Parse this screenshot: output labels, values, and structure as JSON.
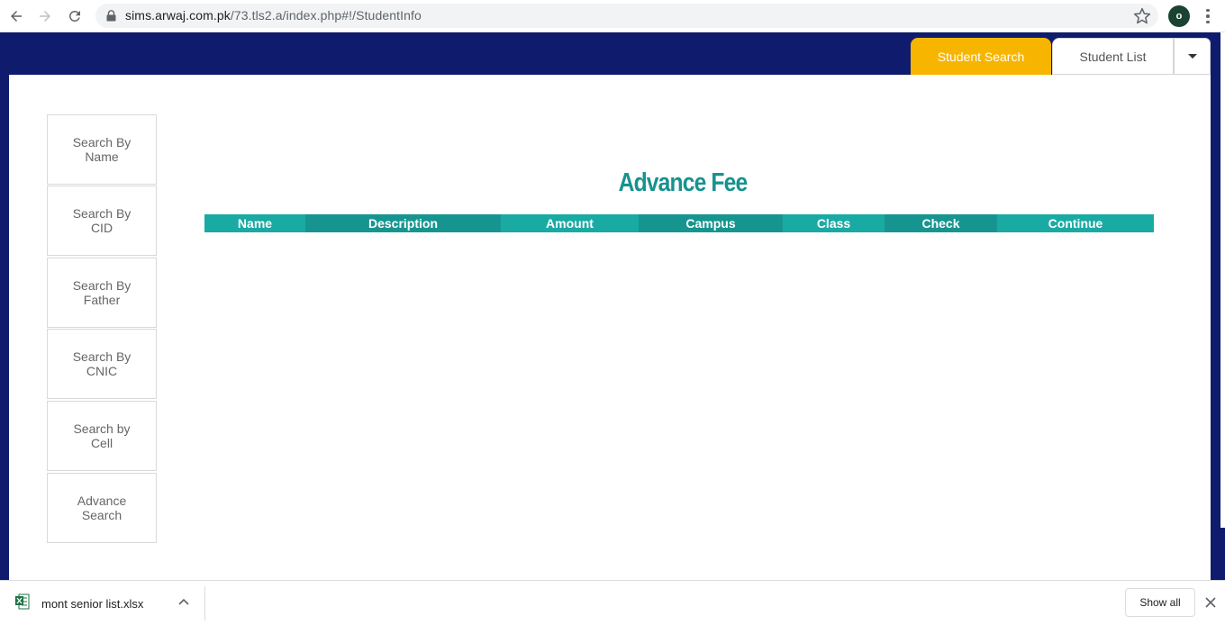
{
  "browser": {
    "url_domain": "sims.arwaj.com.pk",
    "url_path": "/73.tls2.a/index.php#!/StudentInfo",
    "profile_initial": "o"
  },
  "tabs": {
    "student_search": "Student Search",
    "student_list": "Student List"
  },
  "sidebar": {
    "items": [
      {
        "label": "Search By Name"
      },
      {
        "label": "Search By CID"
      },
      {
        "label": "Search By Father"
      },
      {
        "label": "Search By CNIC"
      },
      {
        "label": "Search by Cell"
      },
      {
        "label": "Advance Search"
      }
    ]
  },
  "main": {
    "title": "Advance Fee",
    "columns": [
      "Name",
      "Description",
      "Amount",
      "Campus",
      "Class",
      "Check",
      "Continue"
    ]
  },
  "download": {
    "file_name": "mont senior list.xlsx",
    "show_all": "Show all"
  },
  "colors": {
    "header_bg": "#0f1c6e",
    "active_tab": "#f7b500",
    "title": "#17928f",
    "table_header_light": "#1aaaa4",
    "table_header_dark": "#169590"
  }
}
